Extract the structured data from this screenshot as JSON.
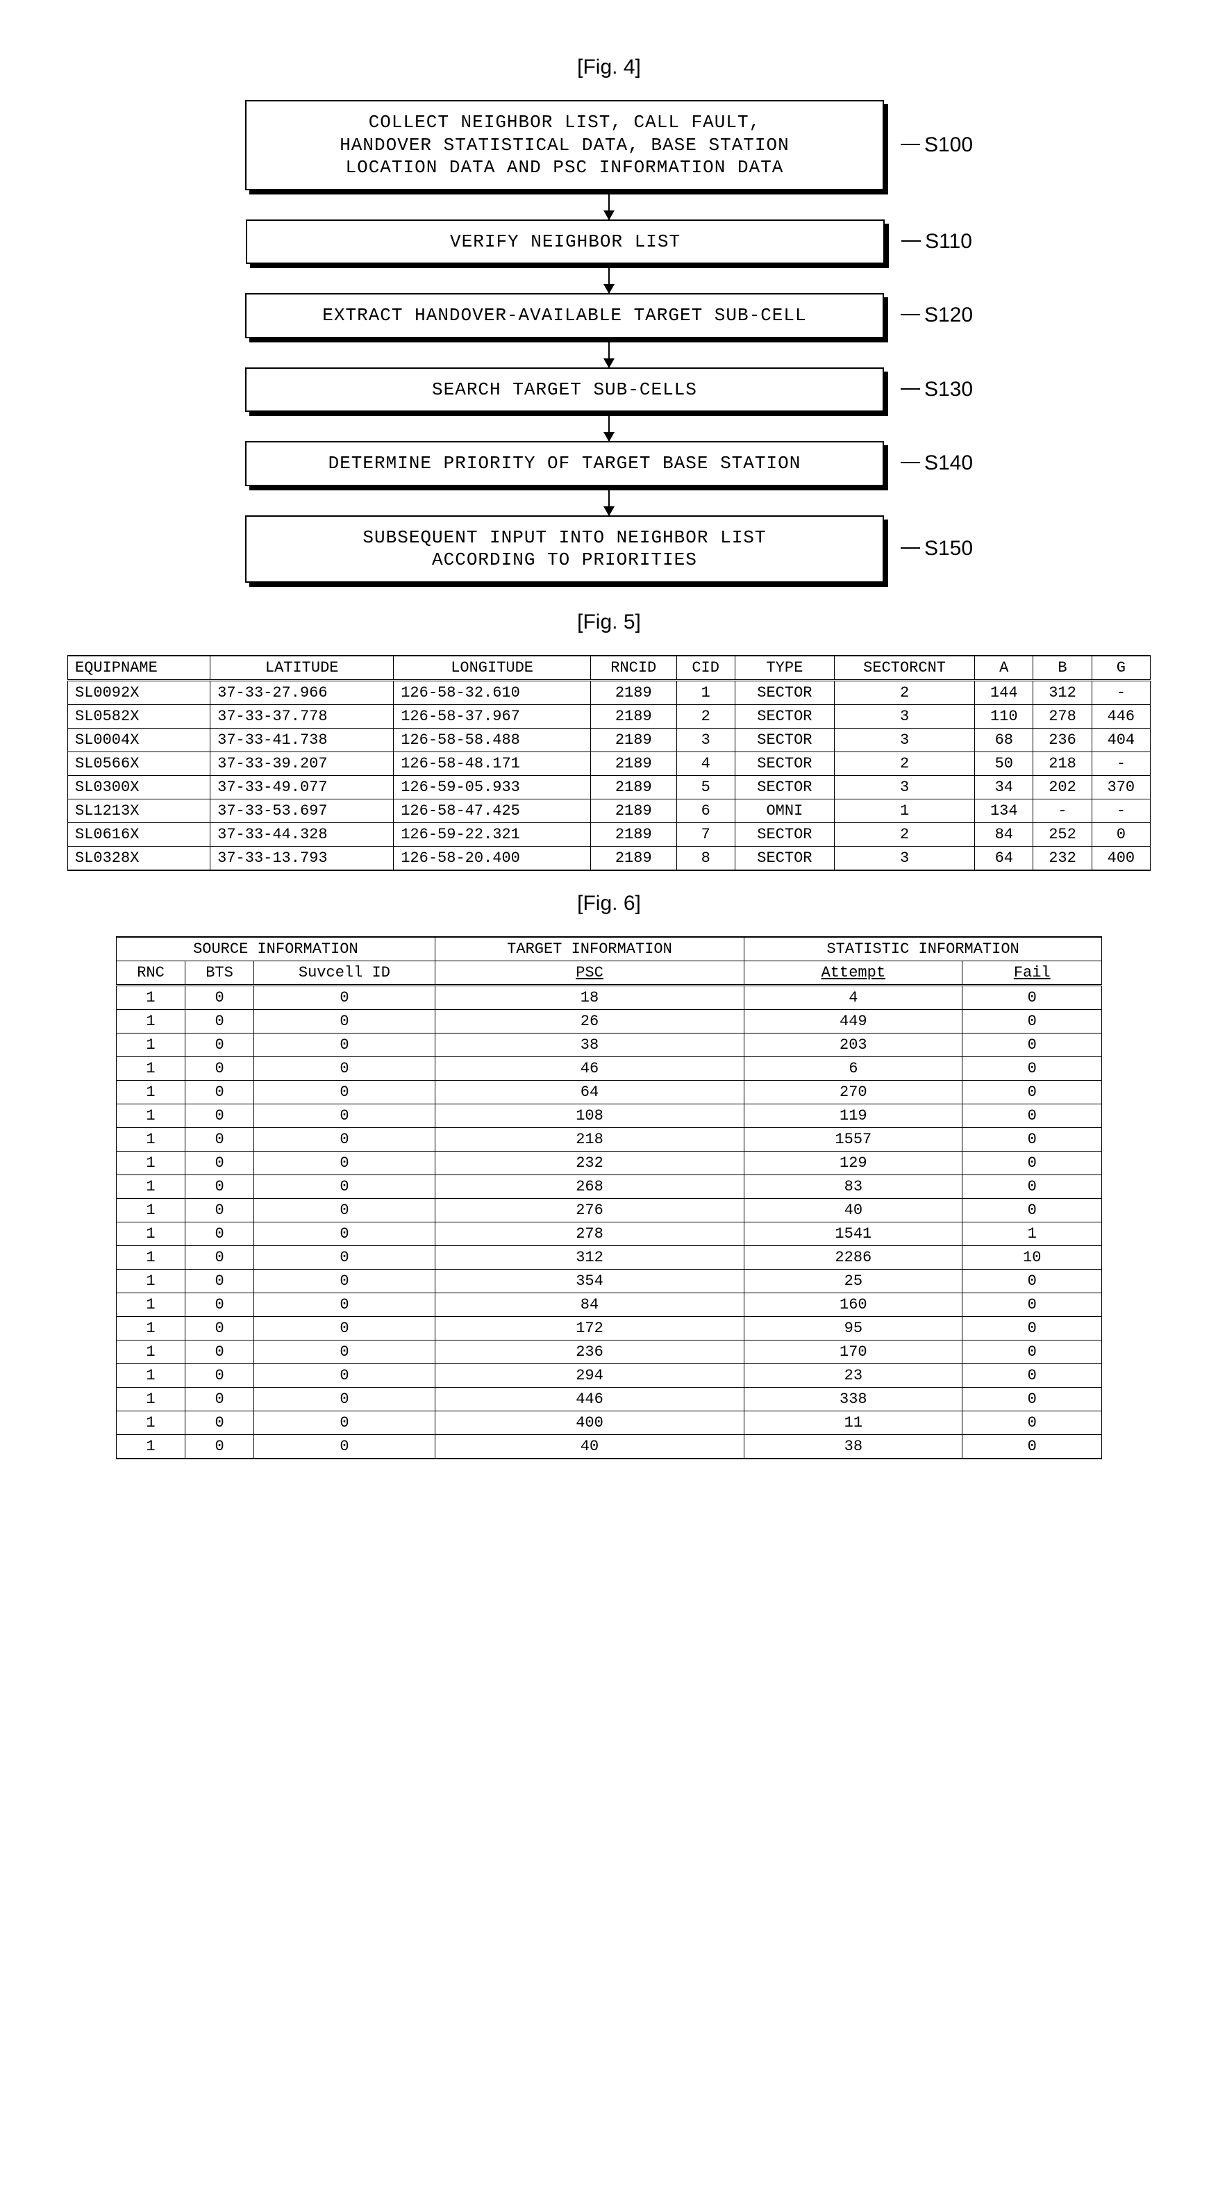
{
  "fig4": {
    "label": "[Fig. 4]",
    "steps": [
      {
        "id": "S100",
        "text": "COLLECT NEIGHBOR LIST, CALL FAULT,\nHANDOVER STATISTICAL DATA, BASE STATION\nLOCATION DATA AND PSC INFORMATION DATA"
      },
      {
        "id": "S110",
        "text": "VERIFY NEIGHBOR LIST"
      },
      {
        "id": "S120",
        "text": "EXTRACT HANDOVER-AVAILABLE TARGET SUB-CELL"
      },
      {
        "id": "S130",
        "text": "SEARCH TARGET SUB-CELLS"
      },
      {
        "id": "S140",
        "text": "DETERMINE PRIORITY OF TARGET BASE STATION"
      },
      {
        "id": "S150",
        "text": "SUBSEQUENT INPUT INTO NEIGHBOR LIST\nACCORDING TO PRIORITIES"
      }
    ]
  },
  "fig5": {
    "label": "[Fig. 5]",
    "headers": [
      "EQUIPNAME",
      "LATITUDE",
      "LONGITUDE",
      "RNCID",
      "CID",
      "TYPE",
      "SECTORCNT",
      "A",
      "B",
      "G"
    ],
    "rows": [
      [
        "SL0092X",
        "37-33-27.966",
        "126-58-32.610",
        "2189",
        "1",
        "SECTOR",
        "2",
        "144",
        "312",
        "-"
      ],
      [
        "SL0582X",
        "37-33-37.778",
        "126-58-37.967",
        "2189",
        "2",
        "SECTOR",
        "3",
        "110",
        "278",
        "446"
      ],
      [
        "SL0004X",
        "37-33-41.738",
        "126-58-58.488",
        "2189",
        "3",
        "SECTOR",
        "3",
        "68",
        "236",
        "404"
      ],
      [
        "SL0566X",
        "37-33-39.207",
        "126-58-48.171",
        "2189",
        "4",
        "SECTOR",
        "2",
        "50",
        "218",
        "-"
      ],
      [
        "SL0300X",
        "37-33-49.077",
        "126-59-05.933",
        "2189",
        "5",
        "SECTOR",
        "3",
        "34",
        "202",
        "370"
      ],
      [
        "SL1213X",
        "37-33-53.697",
        "126-58-47.425",
        "2189",
        "6",
        "OMNI",
        "1",
        "134",
        "-",
        "-"
      ],
      [
        "SL0616X",
        "37-33-44.328",
        "126-59-22.321",
        "2189",
        "7",
        "SECTOR",
        "2",
        "84",
        "252",
        "0"
      ],
      [
        "SL0328X",
        "37-33-13.793",
        "126-58-20.400",
        "2189",
        "8",
        "SECTOR",
        "3",
        "64",
        "232",
        "400"
      ]
    ]
  },
  "fig6": {
    "label": "[Fig. 6]",
    "group_headers": [
      "SOURCE INFORMATION",
      "TARGET INFORMATION",
      "STATISTIC INFORMATION"
    ],
    "sub_headers": [
      "RNC",
      "BTS",
      "Suvcell ID",
      "PSC",
      "Attempt",
      "Fail"
    ],
    "rows": [
      [
        "1",
        "0",
        "0",
        "18",
        "4",
        "0"
      ],
      [
        "1",
        "0",
        "0",
        "26",
        "449",
        "0"
      ],
      [
        "1",
        "0",
        "0",
        "38",
        "203",
        "0"
      ],
      [
        "1",
        "0",
        "0",
        "46",
        "6",
        "0"
      ],
      [
        "1",
        "0",
        "0",
        "64",
        "270",
        "0"
      ],
      [
        "1",
        "0",
        "0",
        "108",
        "119",
        "0"
      ],
      [
        "1",
        "0",
        "0",
        "218",
        "1557",
        "0"
      ],
      [
        "1",
        "0",
        "0",
        "232",
        "129",
        "0"
      ],
      [
        "1",
        "0",
        "0",
        "268",
        "83",
        "0"
      ],
      [
        "1",
        "0",
        "0",
        "276",
        "40",
        "0"
      ],
      [
        "1",
        "0",
        "0",
        "278",
        "1541",
        "1"
      ],
      [
        "1",
        "0",
        "0",
        "312",
        "2286",
        "10"
      ],
      [
        "1",
        "0",
        "0",
        "354",
        "25",
        "0"
      ],
      [
        "1",
        "0",
        "0",
        "84",
        "160",
        "0"
      ],
      [
        "1",
        "0",
        "0",
        "172",
        "95",
        "0"
      ],
      [
        "1",
        "0",
        "0",
        "236",
        "170",
        "0"
      ],
      [
        "1",
        "0",
        "0",
        "294",
        "23",
        "0"
      ],
      [
        "1",
        "0",
        "0",
        "446",
        "338",
        "0"
      ],
      [
        "1",
        "0",
        "0",
        "400",
        "11",
        "0"
      ],
      [
        "1",
        "0",
        "0",
        "40",
        "38",
        "0"
      ]
    ]
  }
}
